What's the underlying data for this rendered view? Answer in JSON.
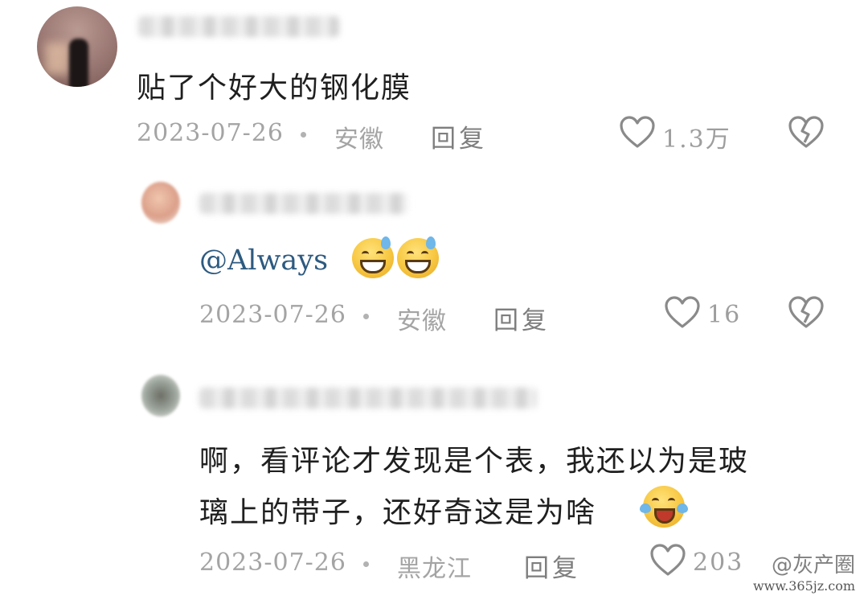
{
  "comments": [
    {
      "text": "贴了个好大的钢化膜",
      "date": "2023-07-26",
      "location": "安徽",
      "reply_label": "回复",
      "likes": "1.3万"
    },
    {
      "mention": "@Always",
      "date": "2023-07-26",
      "location": "安徽",
      "reply_label": "回复",
      "likes": "16"
    },
    {
      "text_line1": "啊，看评论才发现是个表，我还以为是玻",
      "text_line2": "璃上的带子，还好奇这是为啥",
      "date": "2023-07-26",
      "location": "黑龙江",
      "reply_label": "回复",
      "likes": "203"
    }
  ],
  "icons": {
    "like": "heart-outline-icon",
    "dislike": "broken-heart-icon",
    "emoji_sweat": "grinning-sweat-emoji",
    "emoji_cry_laugh": "laughing-tears-emoji"
  },
  "watermark": {
    "brand": "@灰产圈",
    "url": "www.365jz.com"
  },
  "colors": {
    "mention": "#2d5a80",
    "meta": "#a4a4a4",
    "text": "#1f1f1f"
  }
}
